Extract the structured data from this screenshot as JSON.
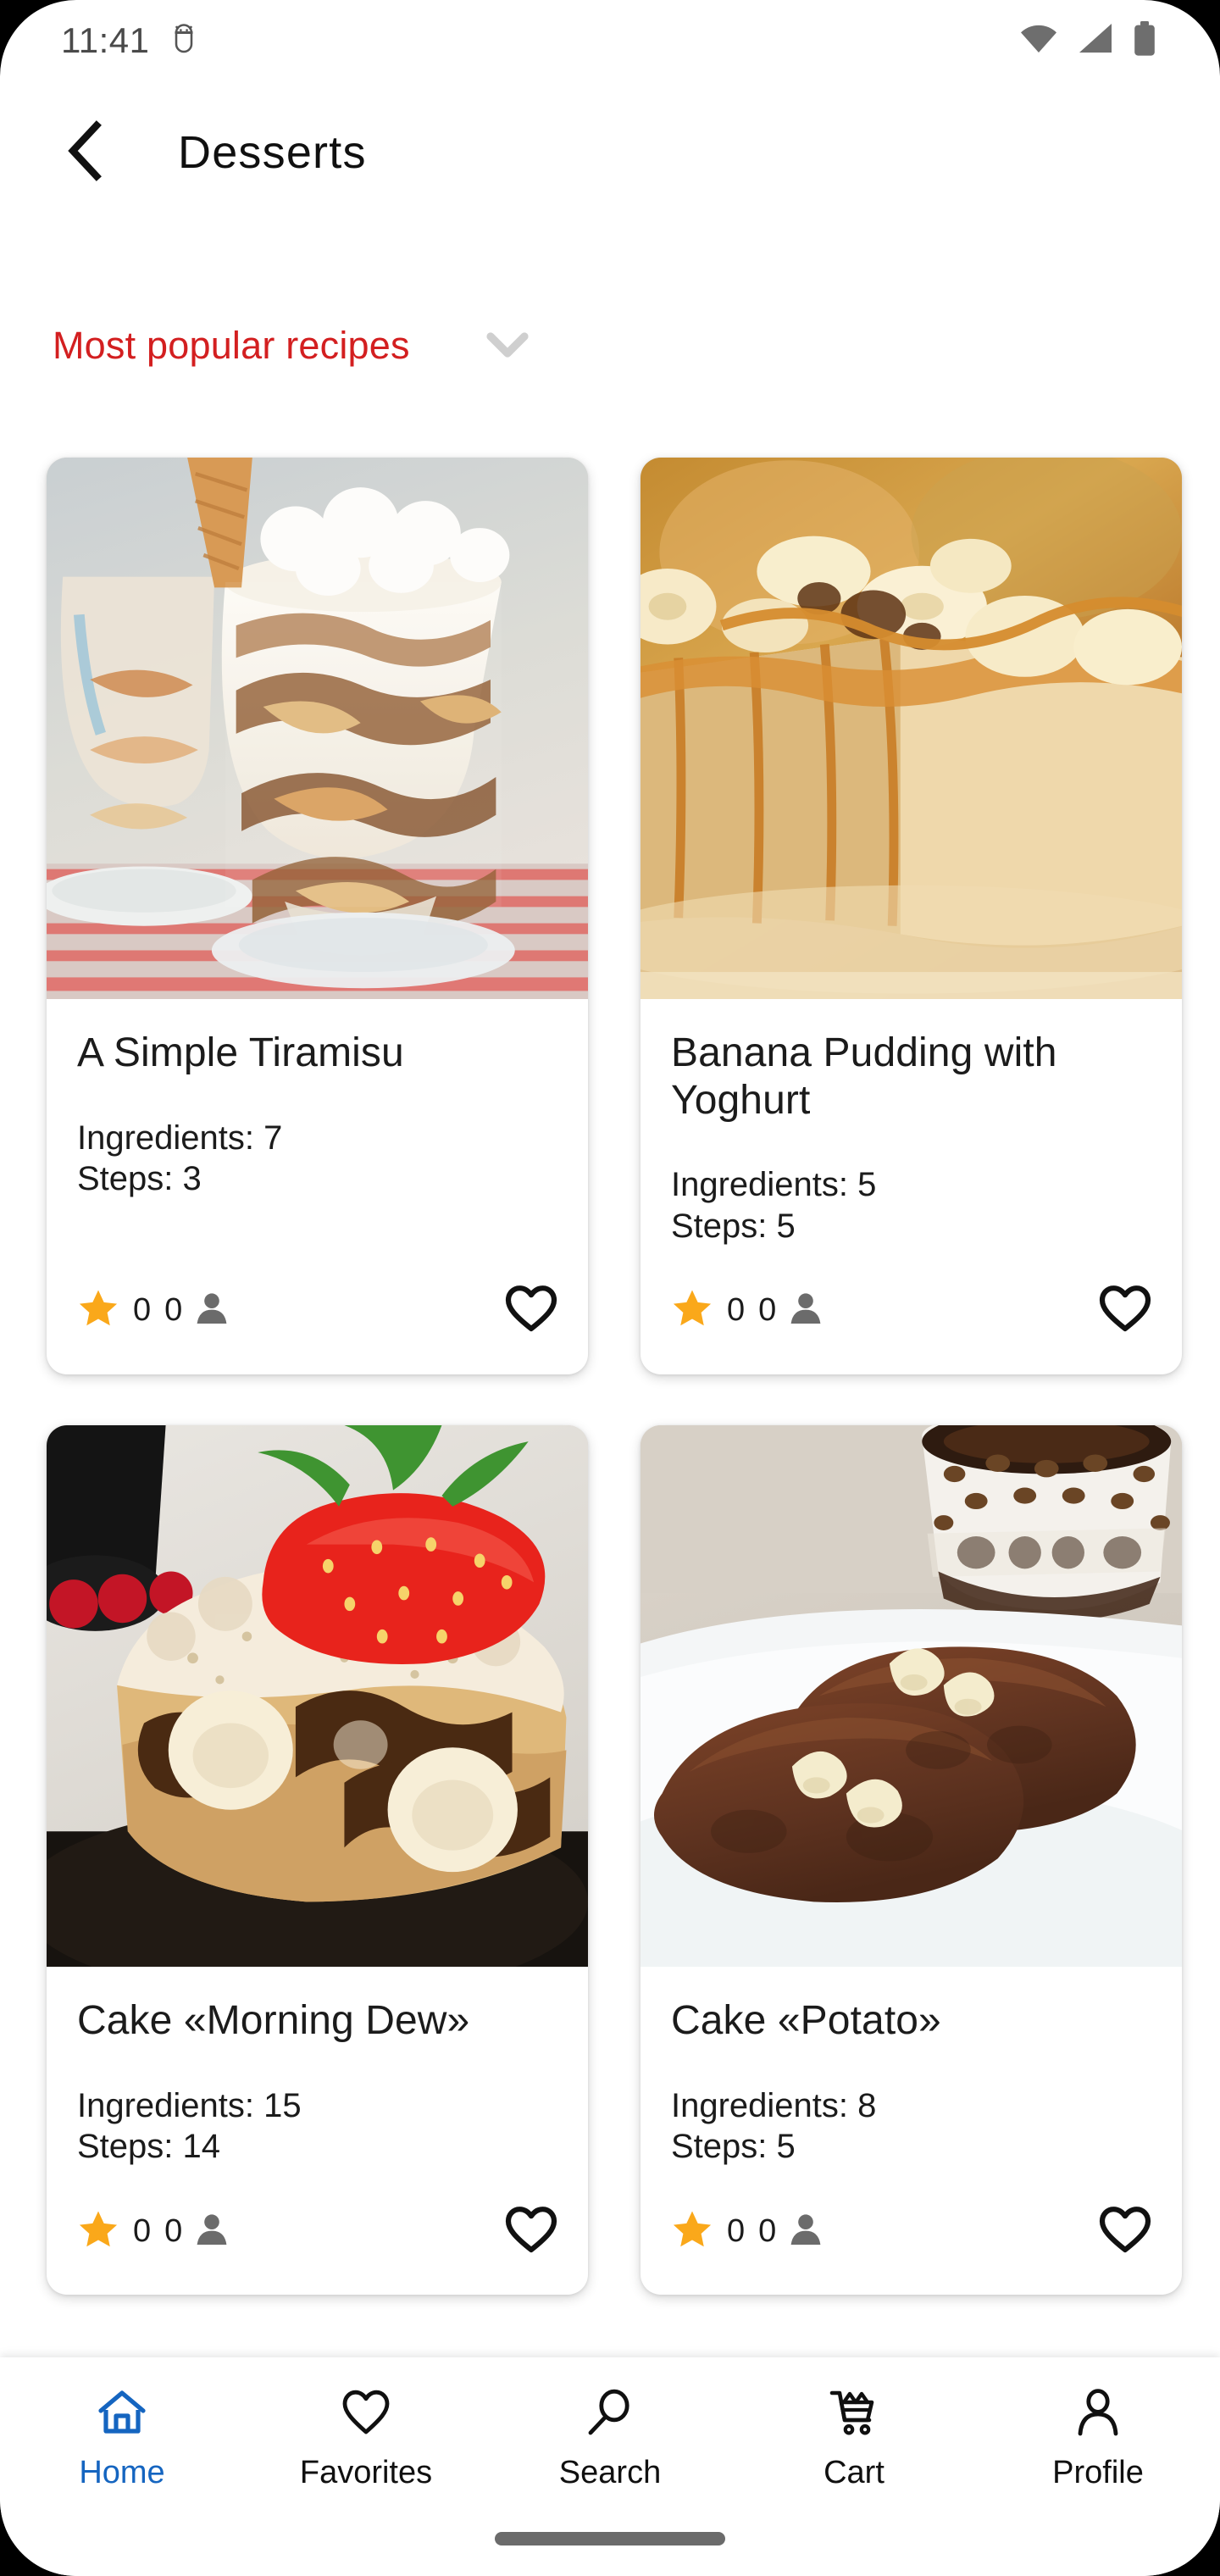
{
  "status_bar": {
    "time": "11:41",
    "icons": [
      "android-head-icon",
      "wifi-icon",
      "cellular-signal-icon",
      "battery-icon"
    ]
  },
  "app_bar": {
    "back_icon": "chevron-left-icon",
    "title": "Desserts"
  },
  "filter": {
    "label": "Most popular recipes",
    "chevron_icon": "chevron-down-icon",
    "color": "#D31F20"
  },
  "labels": {
    "ingredients_prefix": "Ingredients: ",
    "steps_prefix": "Steps: "
  },
  "recipes": [
    {
      "title": "A Simple Tiramisu",
      "ingredients": "Ingredients: 7",
      "steps": "Steps: 3",
      "rating": "0",
      "votes": "0",
      "image_alt": "tiramisu-in-glass"
    },
    {
      "title": "Banana Pudding with Yoghurt",
      "ingredients": "Ingredients: 5",
      "steps": "Steps: 5",
      "rating": "0",
      "votes": "0",
      "image_alt": "banana-pudding-slice"
    },
    {
      "title": "Cake «Morning Dew»",
      "ingredients": "Ingredients: 15",
      "steps": "Steps: 14",
      "rating": "0",
      "votes": "0",
      "image_alt": "strawberry-marble-cake"
    },
    {
      "title": "Cake «Potato»",
      "ingredients": "Ingredients: 8",
      "steps": "Steps: 5",
      "rating": "0",
      "votes": "0",
      "image_alt": "potato-cakes-with-coffee"
    }
  ],
  "bottom_nav": {
    "active_color": "#1565C0",
    "items": [
      {
        "label": "Home",
        "icon": "home-icon",
        "active": true
      },
      {
        "label": "Favorites",
        "icon": "heart-icon",
        "active": false
      },
      {
        "label": "Search",
        "icon": "search-icon",
        "active": false
      },
      {
        "label": "Cart",
        "icon": "cart-icon",
        "active": false
      },
      {
        "label": "Profile",
        "icon": "person-icon",
        "active": false
      }
    ]
  }
}
